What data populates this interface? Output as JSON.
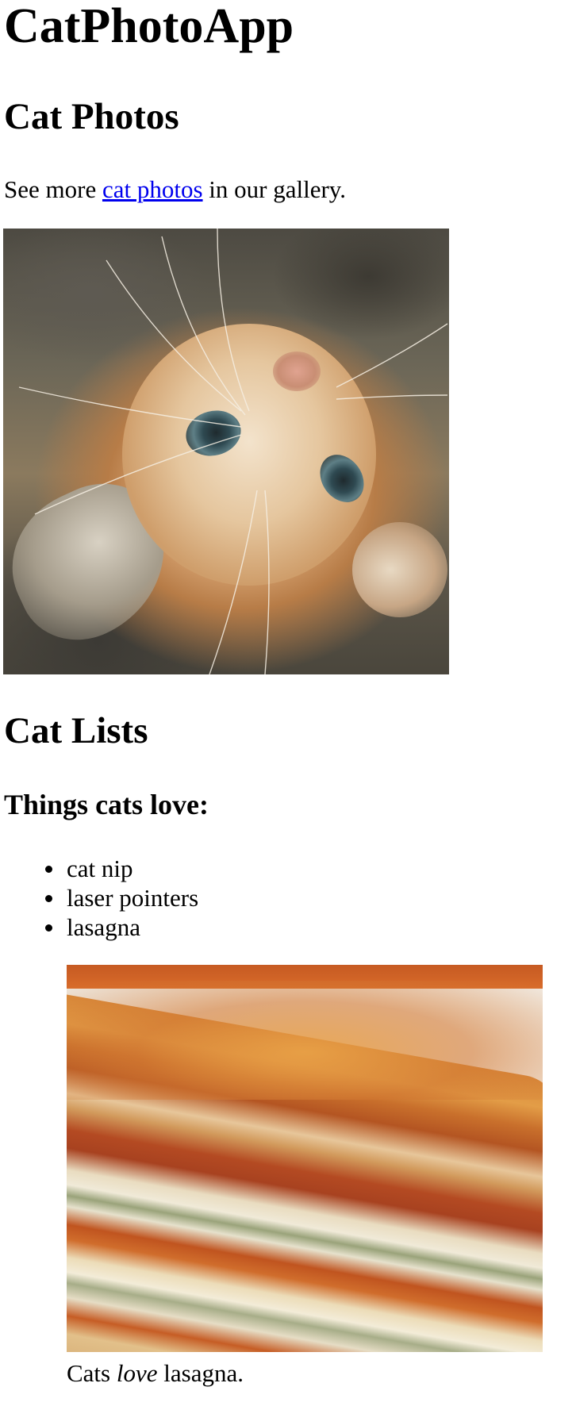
{
  "app_title": "CatPhotoApp",
  "photos_section": {
    "heading": "Cat Photos",
    "gallery_prefix": "See more ",
    "gallery_link_text": "cat photos",
    "gallery_suffix": " in our gallery."
  },
  "kitten_image": {
    "alt": "A cute orange cat lying on its back."
  },
  "lists_section": {
    "heading": "Cat Lists",
    "love_heading": "Things cats love:",
    "love_items": [
      "cat nip",
      "laser pointers",
      "lasagna"
    ]
  },
  "lasagna_figure": {
    "alt": "A slice of lasagna on a plate.",
    "caption_prefix": "Cats ",
    "caption_emphasis": "love",
    "caption_suffix": " lasagna."
  },
  "colors": {
    "link": "#0000ee",
    "text": "#000000",
    "background": "#ffffff"
  }
}
